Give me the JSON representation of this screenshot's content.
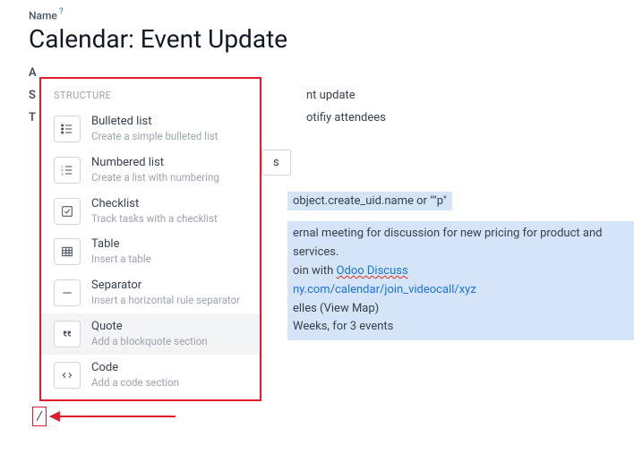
{
  "name_label": "Name",
  "title": "Calendar: Event Update",
  "rows": {
    "a_label": "A",
    "s_label": "S",
    "s_value_partial": "nt update",
    "t_label": "T",
    "t_value_partial": "otifiy attendees"
  },
  "tab_partial": "s",
  "content": {
    "hello_partial": "object.create_uid.name or \"\"p\"",
    "line1_partial": "ernal meeting for discussion for new pricing for product and services.",
    "line2_prefix": "oin with ",
    "line2_link": "Odoo Discuss",
    "line3_partial": "ny.com/calendar/join_videocall/xyz",
    "line4_prefix": "elles ",
    "line4_paren": "(View Map)",
    "line5_partial": "Weeks, for 3 events"
  },
  "slash": "/",
  "dropdown": {
    "header": "STRUCTURE",
    "items": [
      {
        "title": "Bulleted list",
        "desc": "Create a simple bulleted list",
        "icon": "list-ul"
      },
      {
        "title": "Numbered list",
        "desc": "Create a list with numbering",
        "icon": "list-ol"
      },
      {
        "title": "Checklist",
        "desc": "Track tasks with a checklist",
        "icon": "check-square"
      },
      {
        "title": "Table",
        "desc": "Insert a table",
        "icon": "table"
      },
      {
        "title": "Separator",
        "desc": "Insert a horizontal rule separator",
        "icon": "minus"
      },
      {
        "title": "Quote",
        "desc": "Add a blockquote section",
        "icon": "quote",
        "hover": true
      },
      {
        "title": "Code",
        "desc": "Add a code section",
        "icon": "code"
      }
    ]
  }
}
